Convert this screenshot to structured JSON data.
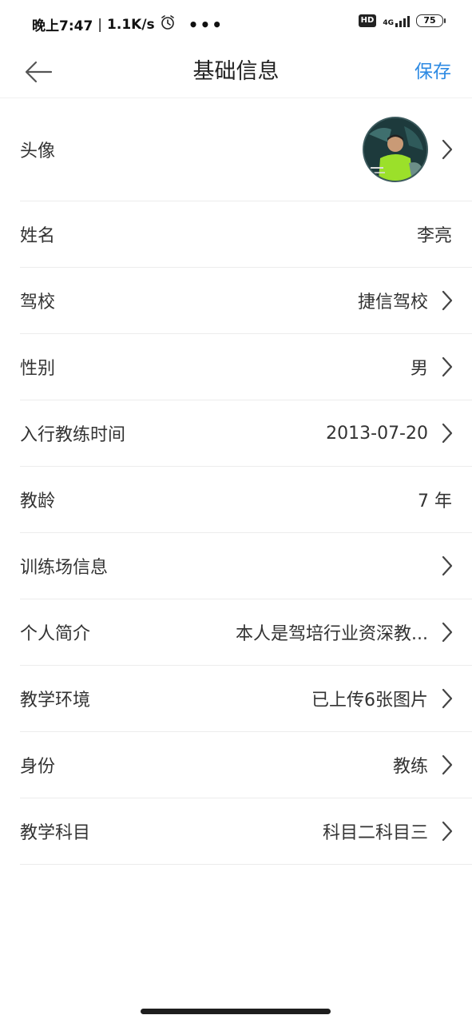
{
  "status_bar": {
    "time": "晚上7:47",
    "separator": "|",
    "speed": "1.1K/s",
    "more": "•••",
    "hd": "HD",
    "network": "4G",
    "battery": "75"
  },
  "header": {
    "title": "基础信息",
    "save_label": "保存"
  },
  "rows": [
    {
      "label": "头像",
      "value": ""
    },
    {
      "label": "姓名",
      "value": "李亮"
    },
    {
      "label": "驾校",
      "value": "捷信驾校"
    },
    {
      "label": "性别",
      "value": "男"
    },
    {
      "label": "入行教练时间",
      "value": "2013-07-20"
    },
    {
      "label": "教龄",
      "value": "7 年"
    },
    {
      "label": "训练场信息",
      "value": ""
    },
    {
      "label": "个人简介",
      "value": "本人是驾培行业资深教..."
    },
    {
      "label": "教学环境",
      "value": "已上传6张图片"
    },
    {
      "label": "身份",
      "value": "教练"
    },
    {
      "label": "教学科目",
      "value": "科目二科目三"
    }
  ],
  "colors": {
    "accent": "#2d8ae3"
  }
}
